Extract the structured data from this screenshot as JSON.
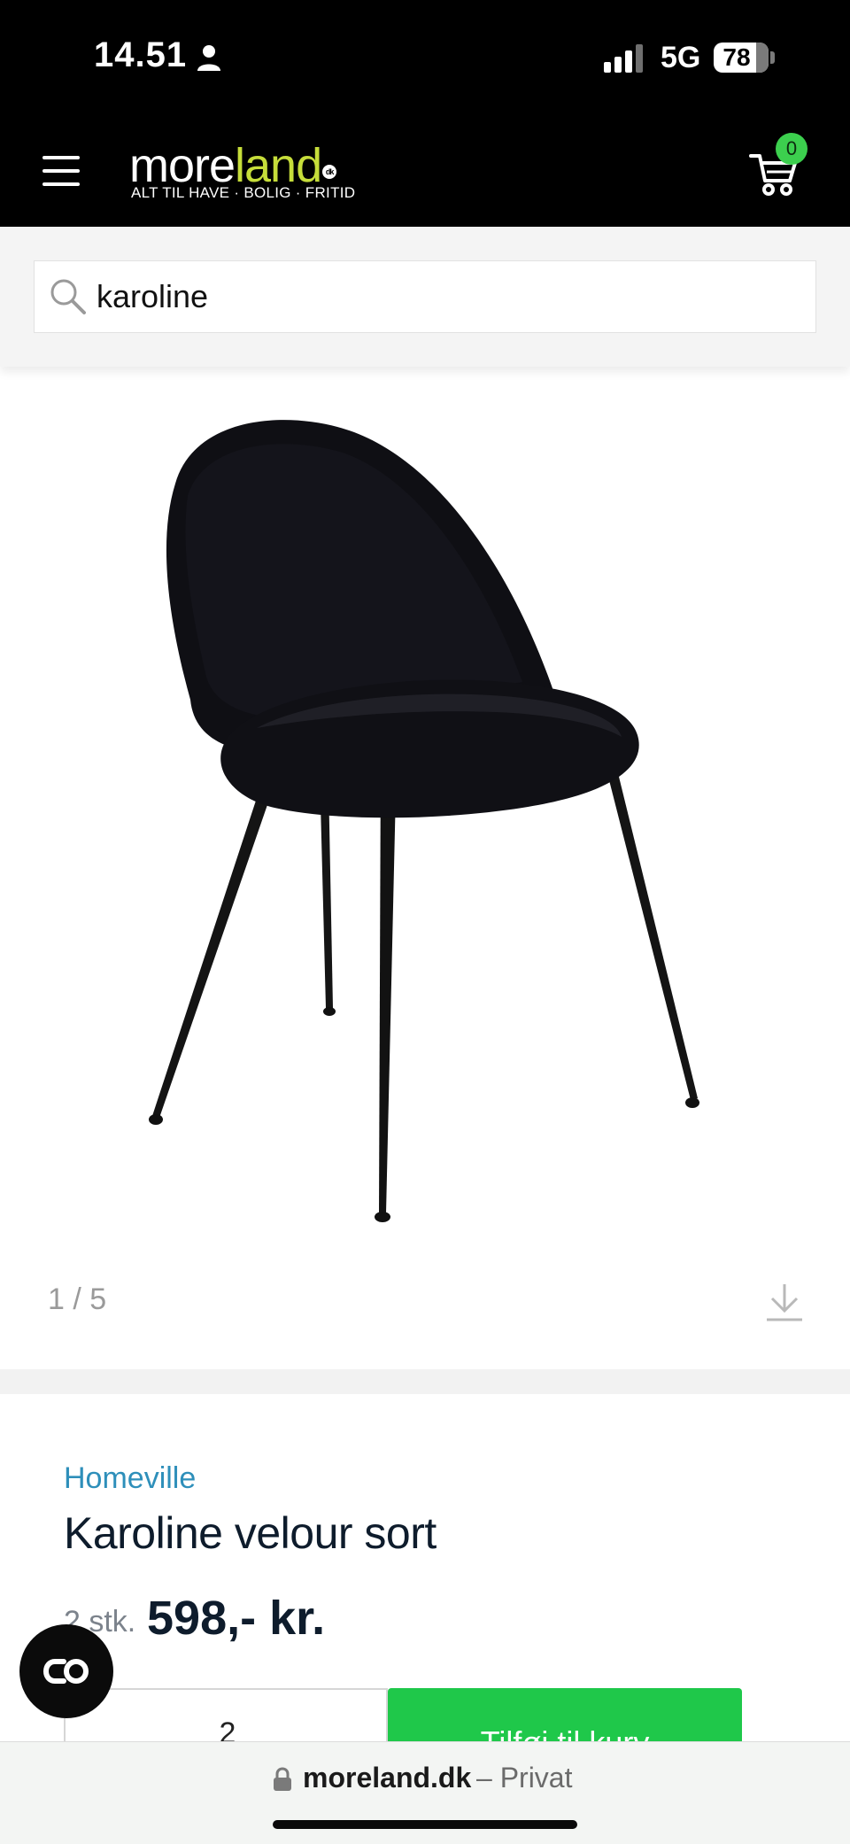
{
  "status_bar": {
    "time": "14.51",
    "network": "5G",
    "battery": "78"
  },
  "header": {
    "logo_more": "more",
    "logo_land": "land",
    "logo_dk": "dk",
    "tagline": "ALT TIL HAVE · BOLIG · FRITID",
    "cart_count": "0"
  },
  "search": {
    "value": "karoline"
  },
  "gallery": {
    "counter": "1 / 5"
  },
  "product": {
    "brand": "Homeville",
    "title": "Karoline velour sort",
    "quantity_label": "2 stk.",
    "price": "598,- kr.",
    "quantity_value": "2",
    "add_to_cart_label": "Tilføj til kurv"
  },
  "browser": {
    "url": "moreland.dk",
    "mode": "– Privat"
  },
  "colors": {
    "header_bg": "#000000",
    "logo_accent": "#c6dd3a",
    "cart_badge": "#3ccf4e",
    "brand_link": "#2e8fba",
    "add_button": "#1fc84a"
  }
}
